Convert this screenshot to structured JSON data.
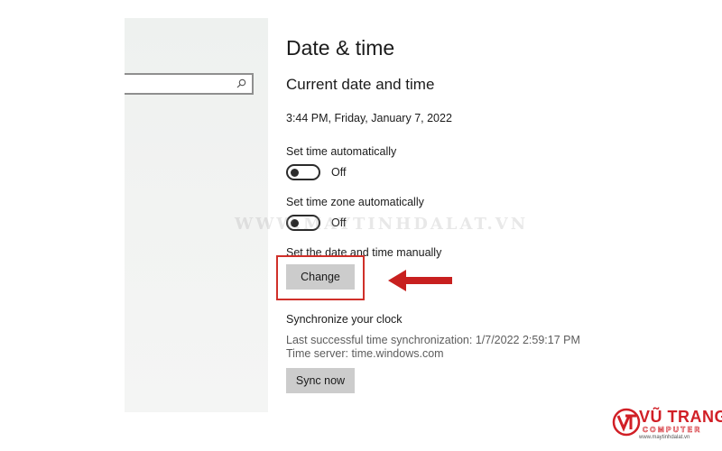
{
  "search": {
    "placeholder": ""
  },
  "page": {
    "title": "Date & time"
  },
  "current": {
    "section_title": "Current date and time",
    "datetime": "3:44 PM, Friday, January 7, 2022"
  },
  "set_time_auto": {
    "label": "Set time automatically",
    "state": "Off"
  },
  "set_timezone_auto": {
    "label": "Set time zone automatically",
    "state": "Off"
  },
  "manual": {
    "label": "Set the date and time manually",
    "button": "Change"
  },
  "sync": {
    "title": "Synchronize your clock",
    "last_sync": "Last successful time synchronization: 1/7/2022 2:59:17 PM",
    "server": "Time server: time.windows.com",
    "button": "Sync now"
  },
  "watermark": "WWW.MAYTINHDALAT.VN",
  "brand": {
    "name": "VŨ TRANG",
    "sub": "COMPUTER",
    "url": "www.maytinhdalat.vn",
    "color": "#d11f26"
  },
  "colors": {
    "highlight": "#d0302a",
    "arrow": "#c8201f",
    "button_bg": "#cccccc"
  }
}
